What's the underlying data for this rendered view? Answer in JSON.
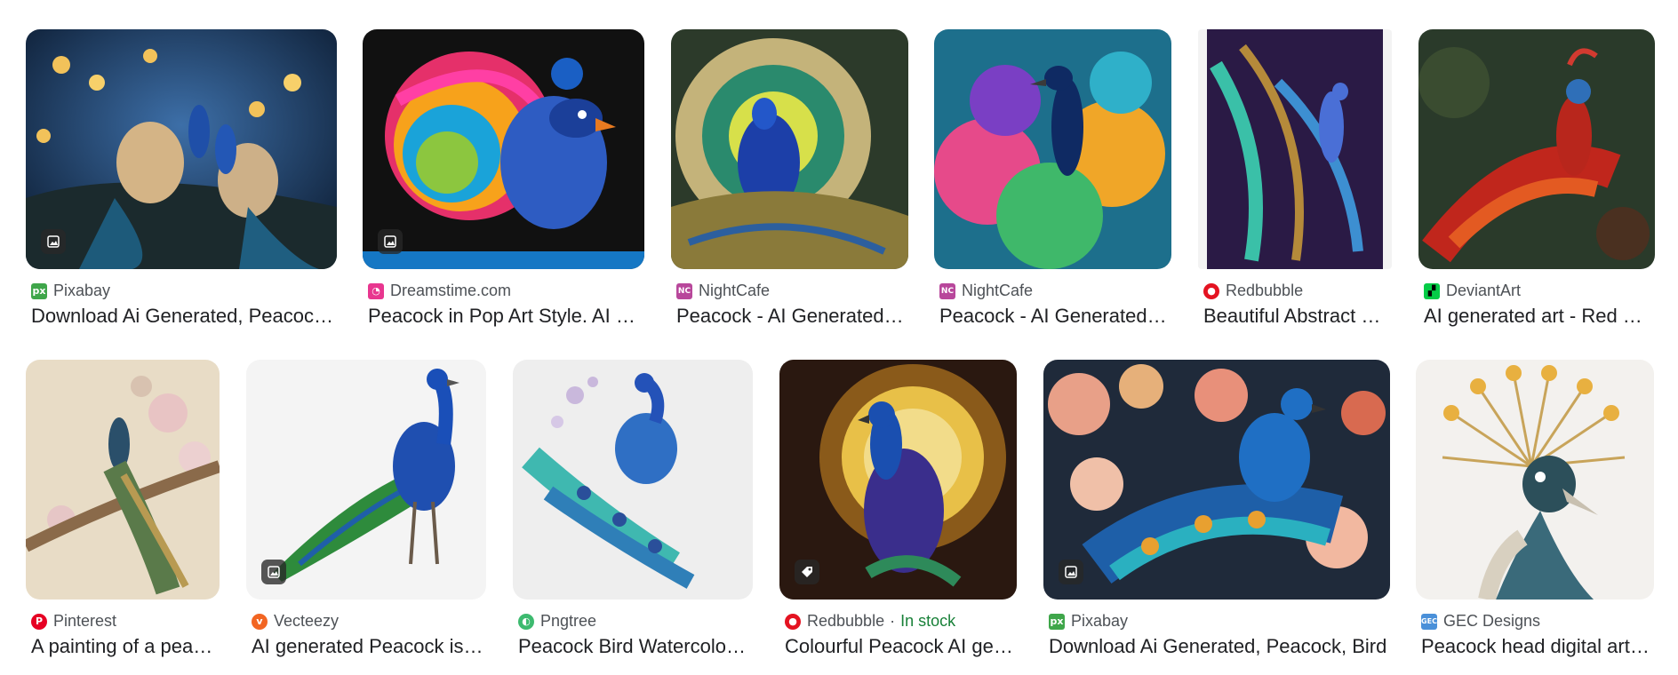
{
  "results": [
    {
      "source": "Pixabay",
      "title": "Download Ai Generated, Peacock, Bird",
      "favicon_color": "#3fa64a",
      "favicon_glyph": "px",
      "badge": "image-icon"
    },
    {
      "source": "Dreamstime.com",
      "title": "Peacock in Pop Art Style. AI Generated",
      "favicon_color": "#e8368f",
      "favicon_glyph": "swirl",
      "badge": "image-icon"
    },
    {
      "source": "NightCafe",
      "title": "Peacock - AI Generated Artwork",
      "favicon_color": "#b8479b",
      "favicon_glyph": "NC",
      "badge": ""
    },
    {
      "source": "NightCafe",
      "title": "Peacock - AI Generated Artwork",
      "favicon_color": "#b8479b",
      "favicon_glyph": "NC",
      "badge": ""
    },
    {
      "source": "Redbubble",
      "title": "Beautiful Abstract Peacock",
      "favicon_color": "#e41321",
      "favicon_glyph": "rb",
      "badge": ""
    },
    {
      "source": "DeviantArt",
      "title": "AI generated art - Red Peacock",
      "favicon_color": "#05cc47",
      "favicon_glyph": "da",
      "badge": ""
    },
    {
      "source": "Pinterest",
      "title": "A painting of a peacock",
      "favicon_color": "#e60023",
      "favicon_glyph": "p",
      "badge": ""
    },
    {
      "source": "Vecteezy",
      "title": "AI generated Peacock isolated",
      "favicon_color": "#f26522",
      "favicon_glyph": "v",
      "badge": "image-icon"
    },
    {
      "source": "Pngtree",
      "title": "Peacock Bird Watercolor Illustration",
      "favicon_color": "#3dba6f",
      "favicon_glyph": "pt",
      "badge": ""
    },
    {
      "source": "Redbubble",
      "in_stock": "In stock",
      "title": "Colourful Peacock AI generated",
      "favicon_color": "#e41321",
      "favicon_glyph": "rb",
      "badge": "tag-icon"
    },
    {
      "source": "Pixabay",
      "title": "Download Ai Generated, Peacock, Bird",
      "favicon_color": "#3fa64a",
      "favicon_glyph": "px",
      "badge": "image-icon"
    },
    {
      "source": "GEC Designs",
      "title": "Peacock head digital artwork",
      "favicon_color": "#4a90d9",
      "favicon_glyph": "gec",
      "badge": ""
    }
  ],
  "separator": "·"
}
